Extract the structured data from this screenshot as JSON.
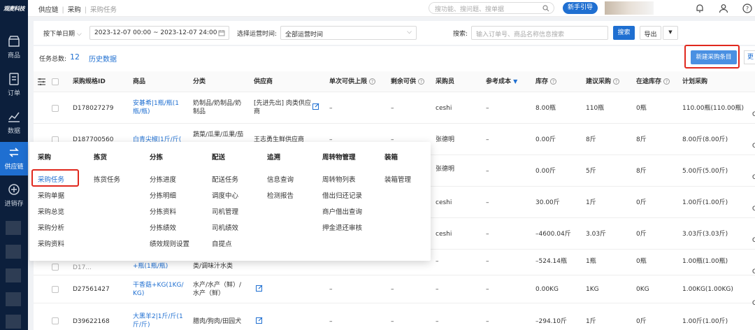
{
  "app": {
    "logo": "观麦科技"
  },
  "sidebar": {
    "items": [
      {
        "label": "商品",
        "icon": "store-icon"
      },
      {
        "label": "订单",
        "icon": "order-icon"
      },
      {
        "label": "数据",
        "icon": "chart-icon"
      },
      {
        "label": "供应链",
        "icon": "supply-chain-icon",
        "active": true
      },
      {
        "label": "进销存",
        "icon": "inventory-icon"
      }
    ]
  },
  "header": {
    "breadcrumb": [
      "供应链",
      "采购",
      "采购任务"
    ],
    "search_placeholder": "搜功能、搜问题、搜单据",
    "guide_label": "新手引导"
  },
  "filters": {
    "date_type": "按下单日期",
    "date_range": "2023-12-07 00:00 ~ 2023-12-07 24:00",
    "op_time_label": "选择运营时间:",
    "op_time_value": "全部运营时间",
    "search_label": "搜索:",
    "search_placeholder": "输入订单号、商品名称信息搜索",
    "search_button": "搜索",
    "export_button": "导出"
  },
  "toolbar": {
    "total_label": "任务总数:",
    "total_count": "12",
    "history_link": "历史数据",
    "new_button": "新建采购条目",
    "more_button": "更"
  },
  "table": {
    "headers": [
      "采购规格ID",
      "商品",
      "分类",
      "供应商",
      "单次可供上限",
      "剩余可供",
      "采购员",
      "参考成本",
      "库存",
      "建议采购",
      "在途库存",
      "计划采购"
    ],
    "rows": [
      {
        "id": "D178027279",
        "product": [
          "安碁希|1瓶/瓶(1",
          "瓶/瓶)"
        ],
        "category": [
          "奶制品/奶制品/奶",
          "制品"
        ],
        "supplier": [
          "[先进先出] 肉类供应",
          "商"
        ],
        "single": "–",
        "remain": "–",
        "buyer": "ceshi",
        "cost": "–",
        "stock": "8.00瓶",
        "suggest": "110瓶",
        "transit": "0瓶",
        "plan": "110.00瓶(110.00瓶)"
      },
      {
        "id": "D187700560",
        "product": [
          "白青尖椒|1斤/斤("
        ],
        "category": [
          "蔬菜/瓜果/瓜果/茄"
        ],
        "supplier": [
          "王志勇生鲜供应商"
        ],
        "single": "–",
        "remain": "–",
        "buyer": "张德明",
        "cost": "–",
        "stock": "0.00斤",
        "suggest": "8斤",
        "transit": "8斤",
        "plan": "8.00斤(8.00斤)"
      },
      {
        "id": "",
        "product": [],
        "category": [],
        "supplier": [],
        "single": "",
        "remain": "",
        "buyer": "张德明",
        "cost": "–",
        "stock": "0.00斤",
        "suggest": "5斤",
        "transit": "8斤",
        "plan": "5.00斤(5.00斤)"
      },
      {
        "id": "",
        "product": [],
        "category": [],
        "supplier": [],
        "single": "",
        "remain": "",
        "buyer": "ceshi",
        "cost": "–",
        "stock": "30.00斤",
        "suggest": "1斤",
        "transit": "0斤",
        "plan": "1.00斤(1.00斤)"
      },
      {
        "id": "",
        "product": [],
        "category": [],
        "supplier": [],
        "single": "",
        "remain": "",
        "buyer": "ceshi",
        "cost": "–",
        "stock": "–4600.04斤",
        "suggest": "3.03斤",
        "transit": "0斤",
        "plan": "3.03斤(3.03斤)"
      },
      {
        "id": "D17...",
        "product": [
          "+瓶(1瓶/瓶)"
        ],
        "category": [
          "类/调味汁水类"
        ],
        "supplier": [],
        "single": "",
        "remain": "",
        "buyer": "–",
        "cost": "–",
        "stock": "–524.14瓶",
        "suggest": "1瓶",
        "transit": "0瓶",
        "plan": "1.00瓶(1.00瓶)"
      },
      {
        "id": "D27561427",
        "product": [
          "干香菇+KG(1KG/",
          "KG)"
        ],
        "category": [
          "水产/水产（鲜）/",
          "水产（鲜）"
        ],
        "supplier": [],
        "single": "–",
        "remain": "–",
        "buyer": "–",
        "cost": "–",
        "stock": "0.00KG",
        "suggest": "1KG",
        "transit": "0KG",
        "plan": "1.00KG(1.00KG)"
      },
      {
        "id": "D39622168",
        "product": [
          "大黑羊2|1斤/斤(1",
          "斤/斤)"
        ],
        "category": [
          "腊肉/狗肉/田园犬"
        ],
        "supplier": [],
        "single": "–",
        "remain": "–",
        "buyer": "–",
        "cost": "–",
        "stock": "–294.10斤",
        "suggest": "1斤",
        "transit": "0斤",
        "plan": "1.00斤(1.00斤)"
      }
    ]
  },
  "mega_menu": {
    "columns": [
      {
        "title": "采购",
        "items": [
          "采购任务",
          "采购单据",
          "采购总览",
          "采购分析",
          "采购资料"
        ]
      },
      {
        "title": "拣货",
        "items": [
          "拣货任务"
        ]
      },
      {
        "title": "分拣",
        "items": [
          "分拣进度",
          "分拣明细",
          "分拣资料",
          "分拣绩效",
          "绩效规则设置"
        ]
      },
      {
        "title": "配送",
        "items": [
          "配送任务",
          "调度中心",
          "司机管理",
          "司机绩效",
          "自提点"
        ]
      },
      {
        "title": "追溯",
        "items": [
          "信息查询",
          "检测报告"
        ]
      },
      {
        "title": "周转物管理",
        "items": [
          "周转物列表",
          "借出归还记录",
          "商户借出查询",
          "押金退还审核"
        ]
      },
      {
        "title": "装箱",
        "items": [
          "装箱管理"
        ]
      }
    ]
  },
  "colors": {
    "sidebar_bg": "#0c1f3c",
    "accent": "#1f6fd1",
    "highlight": "#e0281d"
  }
}
